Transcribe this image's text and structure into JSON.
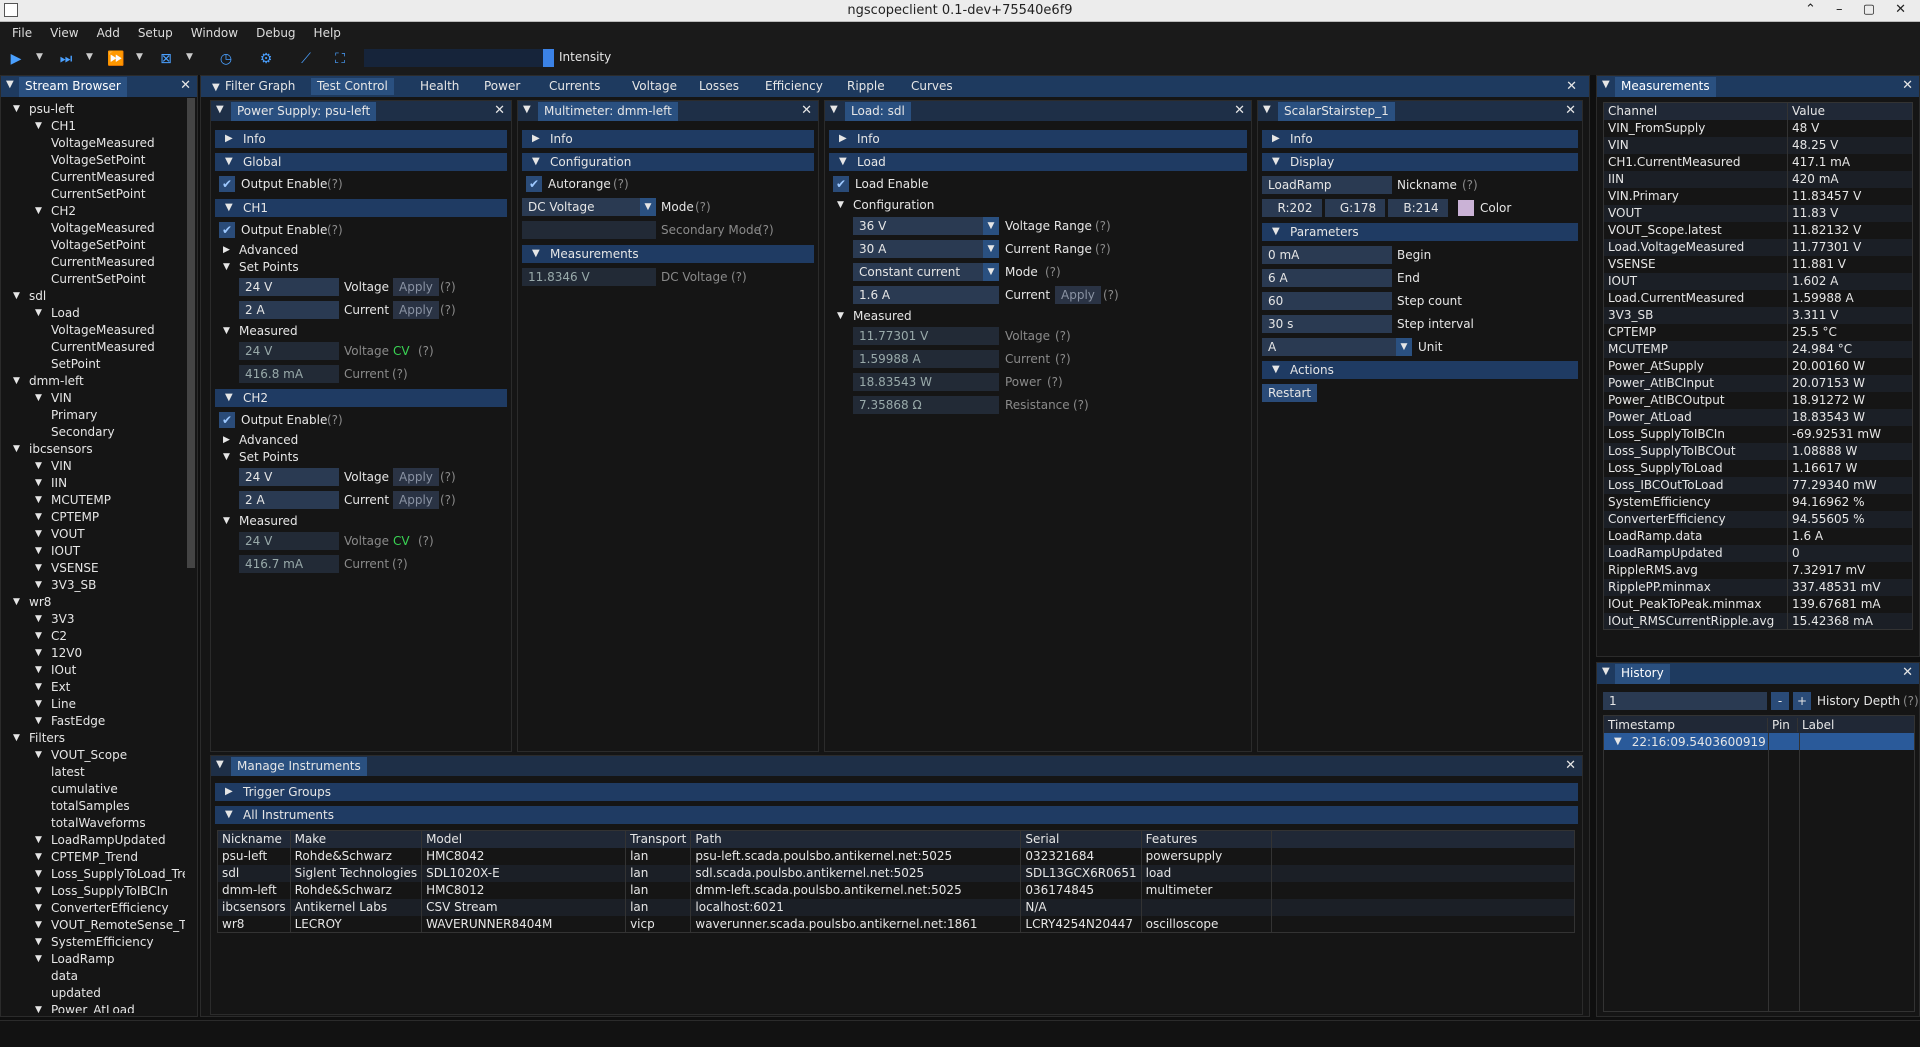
{
  "window": {
    "title": "ngscopeclient 0.1-dev+75540e6f9",
    "controls": "⌃ – ▢ ✕"
  },
  "menu": [
    "File",
    "View",
    "Add",
    "Setup",
    "Window",
    "Debug",
    "Help"
  ],
  "toolbar": {
    "intensity_label": "Intensity",
    "intensity_level": 0.06
  },
  "stream_browser": {
    "title": "Stream Browser",
    "items": [
      {
        "d": 0,
        "t": "psu-left",
        "e": 1
      },
      {
        "d": 1,
        "t": "CH1",
        "e": 1
      },
      {
        "d": 2,
        "t": "VoltageMeasured"
      },
      {
        "d": 2,
        "t": "VoltageSetPoint"
      },
      {
        "d": 2,
        "t": "CurrentMeasured"
      },
      {
        "d": 2,
        "t": "CurrentSetPoint"
      },
      {
        "d": 1,
        "t": "CH2",
        "e": 1
      },
      {
        "d": 2,
        "t": "VoltageMeasured"
      },
      {
        "d": 2,
        "t": "VoltageSetPoint"
      },
      {
        "d": 2,
        "t": "CurrentMeasured"
      },
      {
        "d": 2,
        "t": "CurrentSetPoint"
      },
      {
        "d": 0,
        "t": "sdl",
        "e": 1
      },
      {
        "d": 1,
        "t": "Load",
        "e": 1
      },
      {
        "d": 2,
        "t": "VoltageMeasured"
      },
      {
        "d": 2,
        "t": "CurrentMeasured"
      },
      {
        "d": 2,
        "t": "SetPoint"
      },
      {
        "d": 0,
        "t": "dmm-left",
        "e": 1
      },
      {
        "d": 1,
        "t": "VIN",
        "e": 1
      },
      {
        "d": 2,
        "t": "Primary"
      },
      {
        "d": 2,
        "t": "Secondary"
      },
      {
        "d": 0,
        "t": "ibcsensors",
        "e": 1
      },
      {
        "d": 1,
        "t": "VIN",
        "e": 1
      },
      {
        "d": 1,
        "t": "IIN",
        "e": 1
      },
      {
        "d": 1,
        "t": "MCUTEMP",
        "e": 1
      },
      {
        "d": 1,
        "t": "CPTEMP",
        "e": 1
      },
      {
        "d": 1,
        "t": "VOUT",
        "e": 1
      },
      {
        "d": 1,
        "t": "IOUT",
        "e": 1
      },
      {
        "d": 1,
        "t": "VSENSE",
        "e": 1
      },
      {
        "d": 1,
        "t": "3V3_SB",
        "e": 1
      },
      {
        "d": 0,
        "t": "wr8",
        "e": 1
      },
      {
        "d": 1,
        "t": "3V3",
        "e": 1
      },
      {
        "d": 1,
        "t": "C2",
        "e": 1
      },
      {
        "d": 1,
        "t": "12V0",
        "e": 1
      },
      {
        "d": 1,
        "t": "IOut",
        "e": 1
      },
      {
        "d": 1,
        "t": "Ext",
        "e": 1
      },
      {
        "d": 1,
        "t": "Line",
        "e": 1
      },
      {
        "d": 1,
        "t": "FastEdge",
        "e": 1
      },
      {
        "d": 0,
        "t": "Filters",
        "e": 1
      },
      {
        "d": 1,
        "t": "VOUT_Scope",
        "e": 1
      },
      {
        "d": 2,
        "t": "latest"
      },
      {
        "d": 2,
        "t": "cumulative"
      },
      {
        "d": 2,
        "t": "totalSamples"
      },
      {
        "d": 2,
        "t": "totalWaveforms"
      },
      {
        "d": 1,
        "t": "LoadRampUpdated",
        "e": 1
      },
      {
        "d": 1,
        "t": "CPTEMP_Trend",
        "e": 1
      },
      {
        "d": 1,
        "t": "Loss_SupplyToLoad_Tre",
        "e": 1
      },
      {
        "d": 1,
        "t": "Loss_SupplyToIBCIn",
        "e": 1
      },
      {
        "d": 1,
        "t": "ConverterEfficiency",
        "e": 1
      },
      {
        "d": 1,
        "t": "VOUT_RemoteSense_Tr",
        "e": 1
      },
      {
        "d": 1,
        "t": "SystemEfficiency",
        "e": 1
      },
      {
        "d": 1,
        "t": "LoadRamp",
        "e": 1
      },
      {
        "d": 2,
        "t": "data"
      },
      {
        "d": 2,
        "t": "updated"
      },
      {
        "d": 1,
        "t": "Power_AtLoad",
        "e": 1
      }
    ]
  },
  "tabs": [
    "Filter Graph",
    "Test Control",
    "Health",
    "Power",
    "Currents",
    "Voltage",
    "Losses",
    "Efficiency",
    "Ripple",
    "Curves"
  ],
  "psu": {
    "title": "Power Supply: psu-left",
    "info": "Info",
    "global": "Global",
    "output_enable": "Output Enable",
    "help": "(?)",
    "ch1": {
      "name": "CH1",
      "advanced": "Advanced",
      "set_points": "Set Points",
      "v": "24 V",
      "i": "2 A",
      "measured": "Measured",
      "mv": "24 V",
      "mi": "416.8 mA",
      "cv": "CV"
    },
    "ch2": {
      "name": "CH2",
      "advanced": "Advanced",
      "set_points": "Set Points",
      "v": "24 V",
      "i": "2 A",
      "measured": "Measured",
      "mv": "24 V",
      "mi": "416.7 mA",
      "cv": "CV"
    },
    "voltage": "Voltage",
    "current": "Current",
    "apply": "Apply"
  },
  "dmm": {
    "title": "Multimeter: dmm-left",
    "info": "Info",
    "configuration": "Configuration",
    "autorange": "Autorange",
    "mode_value": "DC Voltage",
    "mode": "Mode",
    "secondary_mode": "Secondary Mode",
    "measurements": "Measurements",
    "reading": "11.8346 V",
    "reading_label": "DC Voltage",
    "help": "(?)"
  },
  "load": {
    "title": "Load: sdl",
    "info": "Info",
    "load": "Load",
    "load_enable": "Load Enable",
    "configuration": "Configuration",
    "vrange": "36 V",
    "vrange_label": "Voltage Range",
    "irange": "30 A",
    "irange_label": "Current Range",
    "mode": "Constant current",
    "mode_label": "Mode",
    "current": "1.6 A",
    "current_label": "Current",
    "apply": "Apply",
    "measured": "Measured",
    "mv": "11.77301 V",
    "mi": "1.59988 A",
    "mp": "18.83543 W",
    "mr": "7.35868 Ω",
    "voltage": "Voltage",
    "current_m": "Current",
    "power": "Power",
    "resistance": "Resistance",
    "help": "(?)"
  },
  "stair": {
    "title": "ScalarStairstep_1",
    "info": "Info",
    "display": "Display",
    "nickname_value": "LoadRamp",
    "nickname": "Nickname",
    "r": "R:202",
    "g": "G:178",
    "b": "B:214",
    "color": "Color",
    "swatch": "#cab2d6",
    "parameters": "Parameters",
    "begin_v": "0 mA",
    "begin": "Begin",
    "end_v": "6 A",
    "end": "End",
    "count_v": "60",
    "count": "Step count",
    "interval_v": "30 s",
    "interval": "Step interval",
    "unit_v": "A",
    "unit": "Unit",
    "actions": "Actions",
    "restart": "Restart",
    "help": "(?)"
  },
  "manage": {
    "title": "Manage Instruments",
    "trigger_groups": "Trigger Groups",
    "all": "All Instruments",
    "cols": [
      "Nickname",
      "Make",
      "Model",
      "Transport",
      "Path",
      "Serial",
      "Features"
    ],
    "rows": [
      [
        "psu-left",
        "Rohde&Schwarz",
        "HMC8042",
        "lan",
        "psu-left.scada.poulsbo.antikernel.net:5025",
        "032321684",
        "powersupply"
      ],
      [
        "sdl",
        "Siglent Technologies",
        "SDL1020X-E",
        "lan",
        "sdl.scada.poulsbo.antikernel.net:5025",
        "SDL13GCX6R0651",
        "load"
      ],
      [
        "dmm-left",
        "Rohde&Schwarz",
        "HMC8012",
        "lan",
        "dmm-left.scada.poulsbo.antikernel.net:5025",
        "036174845",
        "multimeter"
      ],
      [
        "ibcsensors",
        "Antikernel Labs",
        "CSV Stream",
        "lan",
        "localhost:6021",
        "N/A",
        ""
      ],
      [
        "wr8",
        "LECROY",
        "WAVERUNNER8404M",
        "vicp",
        "waverunner.scada.poulsbo.antikernel.net:1861",
        "LCRY4254N20447",
        "oscilloscope"
      ]
    ]
  },
  "measurements": {
    "title": "Measurements",
    "cols": [
      "Channel",
      "Value"
    ],
    "rows": [
      [
        "VIN_FromSupply",
        "48 V"
      ],
      [
        "VIN",
        "48.25 V"
      ],
      [
        "CH1.CurrentMeasured",
        "417.1 mA"
      ],
      [
        "IIN",
        "420 mA"
      ],
      [
        "VIN.Primary",
        "11.83457 V"
      ],
      [
        "VOUT",
        "11.83 V"
      ],
      [
        "VOUT_Scope.latest",
        "11.82132 V"
      ],
      [
        "Load.VoltageMeasured",
        "11.77301 V"
      ],
      [
        "VSENSE",
        "11.881 V"
      ],
      [
        "IOUT",
        "1.602 A"
      ],
      [
        "Load.CurrentMeasured",
        "1.59988 A"
      ],
      [
        "3V3_SB",
        "3.311 V"
      ],
      [
        "CPTEMP",
        "25.5 °C"
      ],
      [
        "MCUTEMP",
        "24.984 °C"
      ],
      [
        "Power_AtSupply",
        "20.00160 W"
      ],
      [
        "Power_AtIBCInput",
        "20.07153 W"
      ],
      [
        "Power_AtIBCOutput",
        "18.91272 W"
      ],
      [
        "Power_AtLoad",
        "18.83543 W"
      ],
      [
        "Loss_SupplyToIBCIn",
        "-69.92531 mW"
      ],
      [
        "Loss_SupplyToIBCOut",
        "1.08888 W"
      ],
      [
        "Loss_SupplyToLoad",
        "1.16617 W"
      ],
      [
        "Loss_IBCOutToLoad",
        "77.29340 mW"
      ],
      [
        "SystemEfficiency",
        "94.16962 %"
      ],
      [
        "ConverterEfficiency",
        "94.55605 %"
      ],
      [
        "LoadRamp.data",
        "1.6 A"
      ],
      [
        "LoadRampUpdated",
        "0"
      ],
      [
        "RippleRMS.avg",
        "7.32917 mV"
      ],
      [
        "RipplePP.minmax",
        "337.48531 mV"
      ],
      [
        "IOut_PeakToPeak.minmax",
        "139.67681 mA"
      ],
      [
        "IOut_RMSCurrentRipple.avg",
        "15.42368 mA"
      ]
    ]
  },
  "history": {
    "title": "History",
    "depth_value": "1",
    "minus": "-",
    "plus": "+",
    "depth_label": "History Depth",
    "help": "(?)",
    "cols": [
      "Timestamp",
      "Pin",
      "Label"
    ],
    "row": "22:16:09.5403600919"
  }
}
